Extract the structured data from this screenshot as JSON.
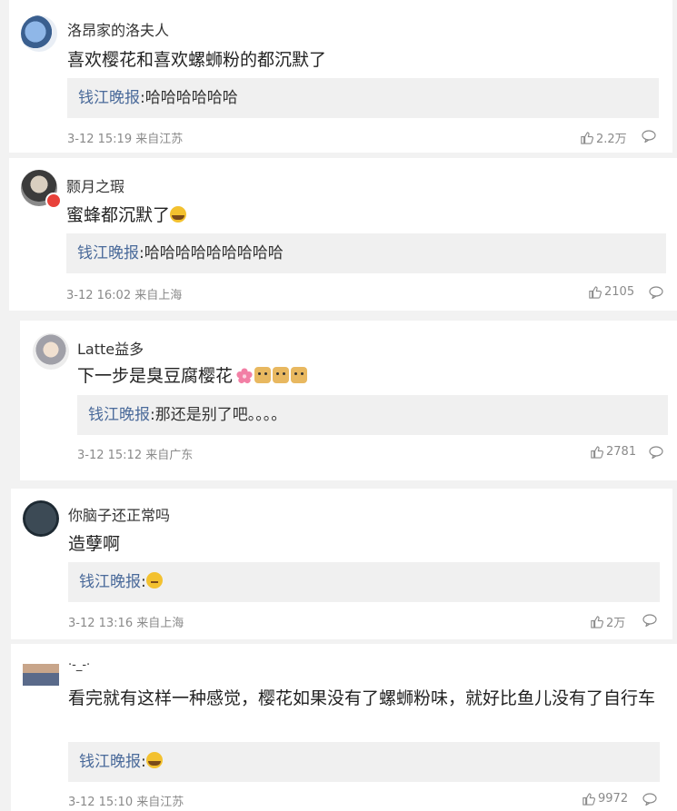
{
  "comments": [
    {
      "username": "洛昂家的洛夫人",
      "content": "喜欢樱花和喜欢螺蛳粉的都沉默了",
      "reply_name": "钱江晚报",
      "reply_text": ":哈哈哈哈哈哈",
      "meta": "3-12 15:19 来自江苏",
      "likes": "2.2万"
    },
    {
      "username": "颢月之瑕",
      "content": "蜜蜂都沉默了",
      "reply_name": "钱江晚报",
      "reply_text": ":哈哈哈哈哈哈哈哈哈",
      "meta": "3-12 16:02 来自上海",
      "likes": "2105"
    },
    {
      "username": "Latte益多",
      "content": "下一步是臭豆腐樱花",
      "reply_name": "钱江晚报",
      "reply_text": ":那还是别了吧。。。。",
      "meta": "3-12 15:12 来自广东",
      "likes": "2781"
    },
    {
      "username": "你脑子还正常吗",
      "content": "造孽啊",
      "reply_name": "钱江晚报",
      "reply_text": ":",
      "meta": "3-12 13:16 来自上海",
      "likes": "2万"
    },
    {
      "username": "·-_-·",
      "content": "看完就有这样一种感觉，樱花如果没有了螺蛳粉味，就好比鱼儿没有了自行车",
      "reply_name": "钱江晚报",
      "reply_text": ":",
      "meta": "3-12 15:10 来自江苏",
      "likes": "9972"
    }
  ],
  "icons": {
    "like": "thumbs-up-icon",
    "comment": "comment-bubble-icon"
  },
  "colors": {
    "reply_name": "#4a6a9a",
    "meta": "#8a8a8a",
    "reply_bg": "#f0f0f0"
  }
}
